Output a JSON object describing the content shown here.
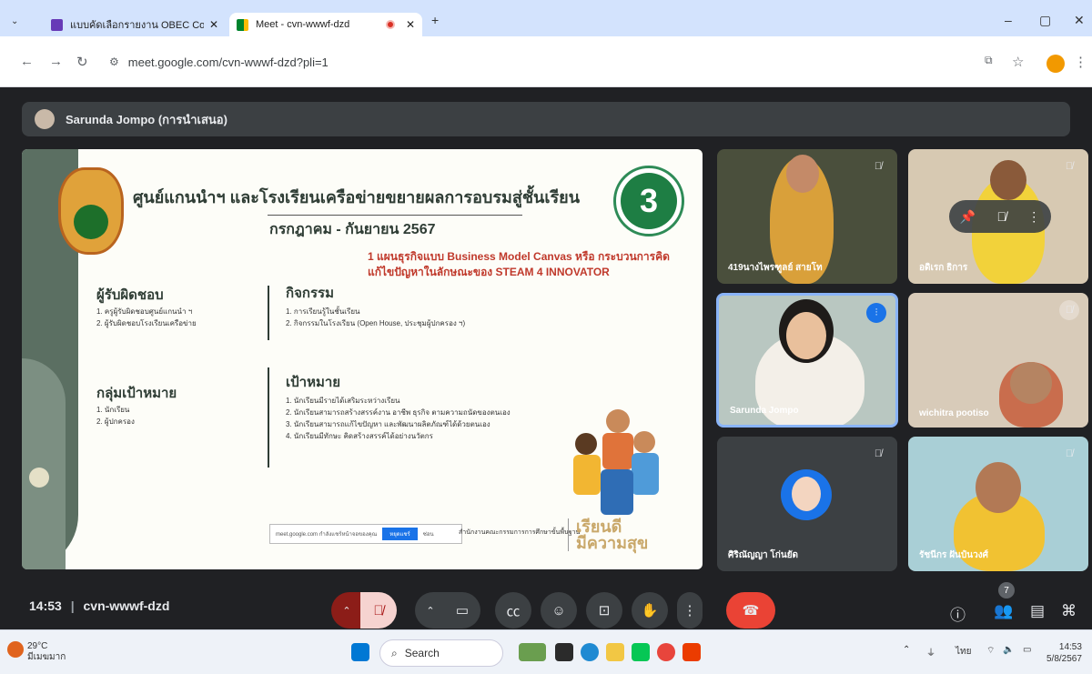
{
  "browser": {
    "tabs": [
      {
        "title": "แบบคัดเลือกรายงาน OBEC Conten",
        "active": false
      },
      {
        "title": "Meet - cvn-wwwf-dzd",
        "active": true
      }
    ],
    "new_tab": "+",
    "url": "meet.google.com/cvn-wwwf-dzd?pli=1",
    "window_controls": [
      "–",
      "▢",
      "✕"
    ]
  },
  "meet": {
    "presenter": "Sarunda Jompo (การนำเสนอ)",
    "slide": {
      "title": "ศูนย์แกนนำฯ และโรงเรียนเครือข่ายขยายผลการอบรมสู่ชั้นเรียน",
      "subtitle": "กรกฎาคม - กันยายน 2567",
      "number": "3",
      "highlight": "1 แผนธุรกิจแบบ Business Model Canvas หรือ กระบวนการคิดแก้ไขปัญหาในลักษณะของ STEAM 4 INNOVATOR",
      "responsible_heading": "ผู้รับผิดชอบ",
      "responsible": [
        "1. ครูผู้รับผิดชอบศูนย์แกนนำ ฯ",
        "2. ผู้รับผิดชอบโรงเรียนเครือข่าย"
      ],
      "activity_heading": "กิจกรรม",
      "activities": [
        "1. การเรียนรู้ในชั้นเรียน",
        "2. กิจกรรมในโรงเรียน (Open House, ประชุมผู้ปกครอง ฯ)"
      ],
      "target_heading": "กลุ่มเป้าหมาย",
      "targets": [
        "1. นักเรียน",
        "2. ผู้ปกครอง"
      ],
      "goal_heading": "เป้าหมาย",
      "goals": [
        "1. นักเรียนมีรายได้เสริมระหว่างเรียน",
        "2. นักเรียนสามารถสร้างสรรค์งาน อาชีพ ธุรกิจ ตามความถนัดของตนเอง",
        "3. นักเรียนสามารถแก้ไขปัญหา และพัฒนาผลิตภัณฑ์ได้ด้วยตนเอง",
        "4. นักเรียนมีทักษะ คิดสร้างสรรค์ได้อย่างนวัตกร"
      ],
      "share_notice": "meet.google.com กำลังแชร์หน้าจอของคุณ",
      "share_button": "หยุดแชร์",
      "share_hide": "ซ่อน",
      "ministry": "สำนักงานคณะกรรมการการศึกษาขั้นพื้นฐาน",
      "motto_line1": "เรียนดี",
      "motto_line2": "มีความสุข"
    },
    "participants": [
      {
        "name": "419นางไพรฑูลย์ สายโท",
        "muted": true
      },
      {
        "name": "อดิเรก ธิการ",
        "muted": true
      },
      {
        "name": "Sarunda Jompo",
        "muted": false,
        "speaking": true
      },
      {
        "name": "wichitra pootiso",
        "muted": true
      },
      {
        "name": "ศิริณัญญา โก่นยัด",
        "muted": true
      },
      {
        "name": "รัชนีกร ฝันป๋นวงศ์",
        "muted": true
      }
    ],
    "meeting_time": "14:53",
    "meeting_code": "cvn-wwwf-dzd",
    "participant_count": "7",
    "colors": {
      "end_call": "#ea4335",
      "mic_off": "#f6d3d0",
      "accent": "#1a73e8"
    }
  },
  "taskbar": {
    "temperature": "29°C",
    "weather_label": "มีเมฆมาก",
    "search_placeholder": "Search",
    "language": "ไทย",
    "time": "14:53",
    "date": "5/8/2567"
  }
}
